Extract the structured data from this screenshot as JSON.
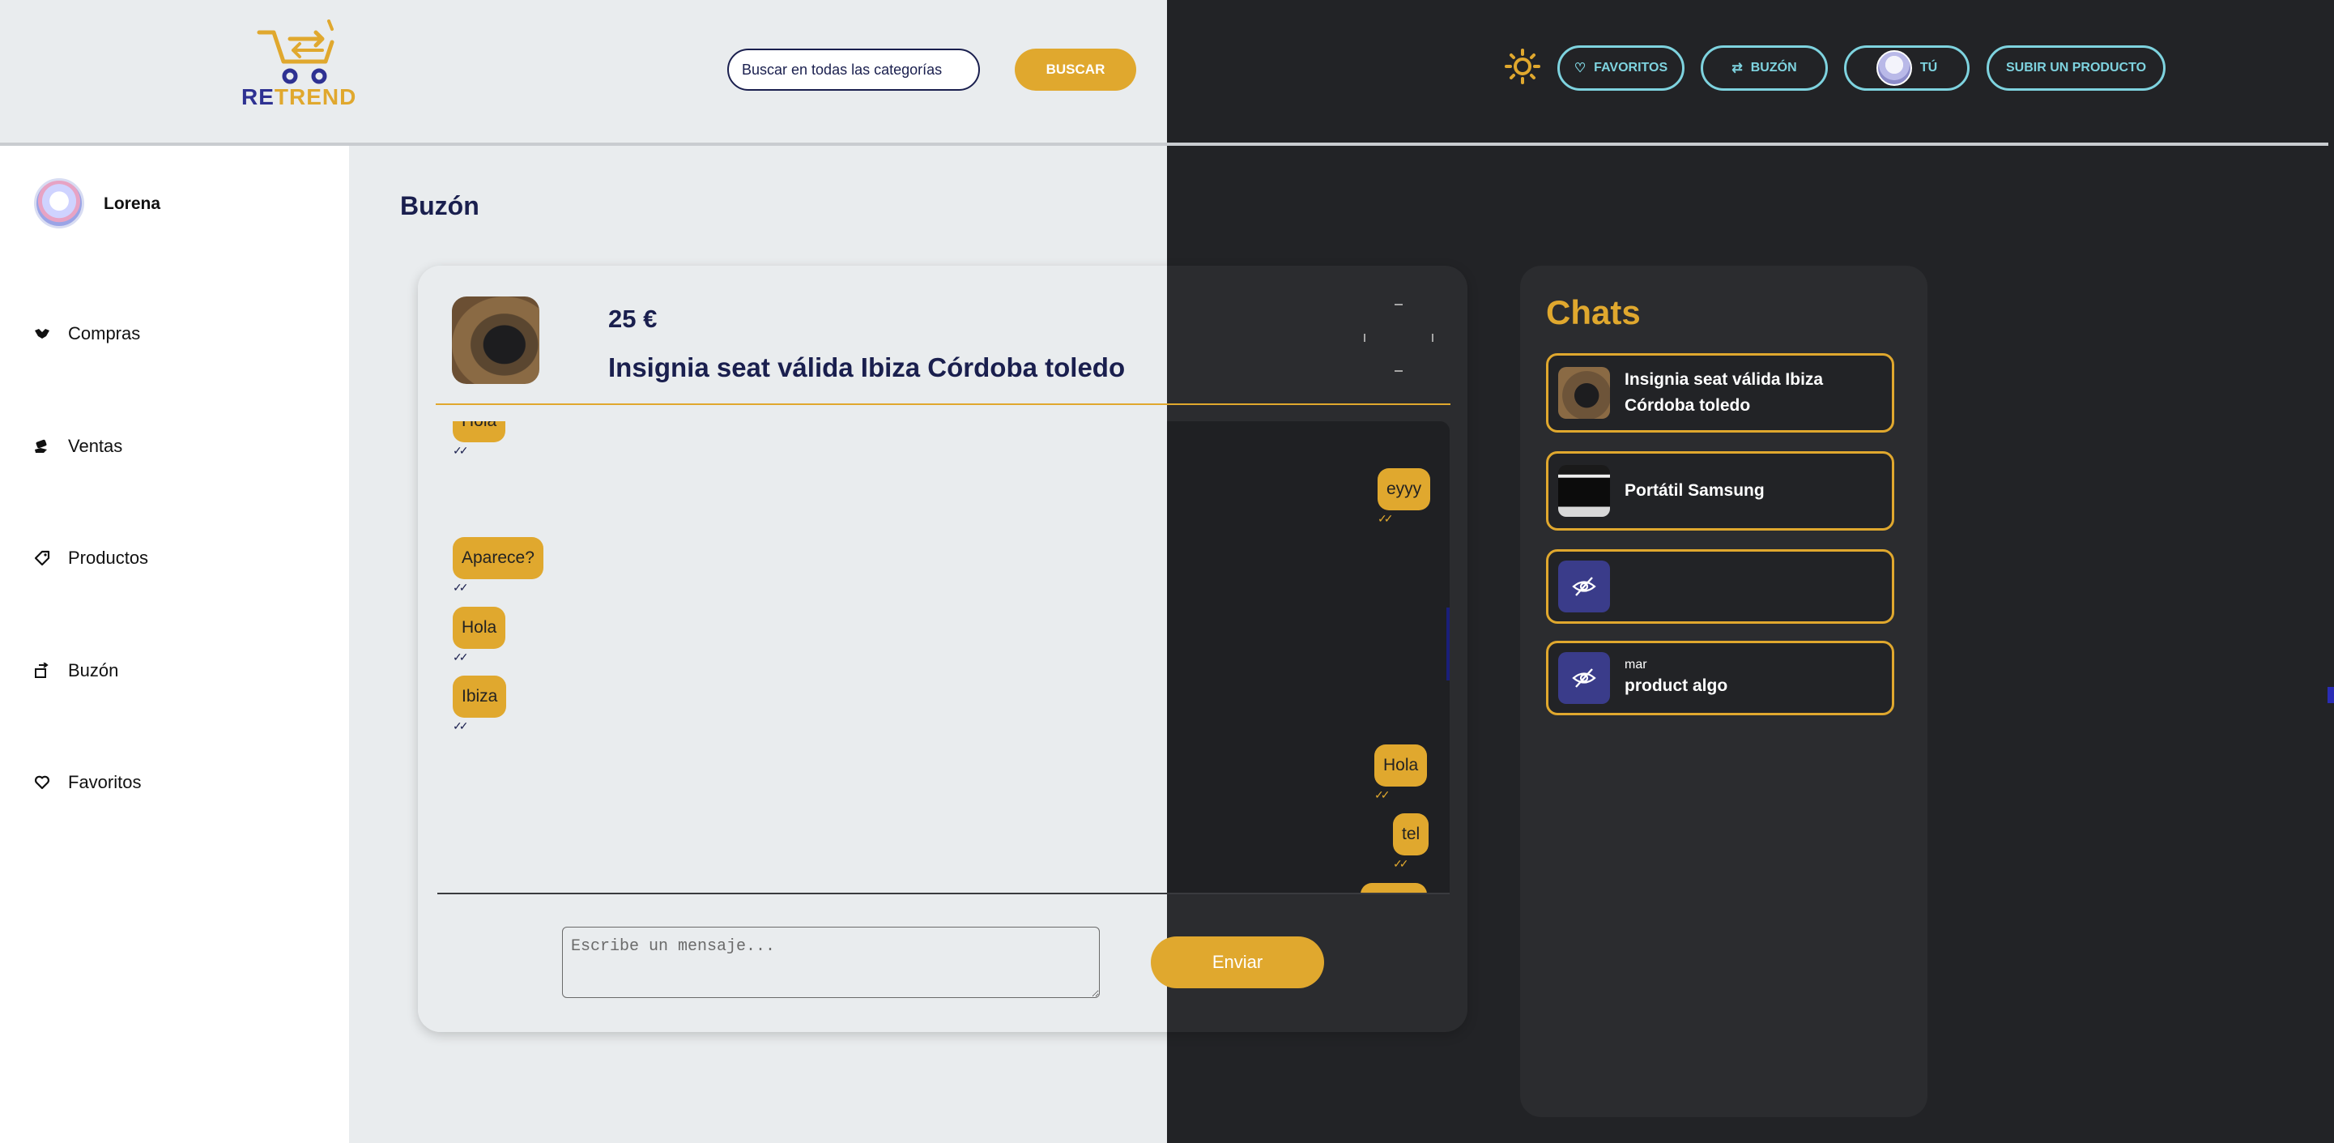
{
  "header": {
    "logo": {
      "re": "RE",
      "trend": "TREND"
    },
    "search": {
      "placeholder": "Buscar en todas las categorías",
      "button_label": "BUSCAR"
    },
    "nav": {
      "favoritos": "FAVORITOS",
      "buzon": "BUZÓN",
      "tu": "TÚ",
      "upload": "SUBIR UN PRODUCTO"
    }
  },
  "sidebar": {
    "user_name": "Lorena",
    "items": [
      {
        "label": "Compras",
        "icon": "handshake-icon"
      },
      {
        "label": "Ventas",
        "icon": "money-hand-icon"
      },
      {
        "label": "Productos",
        "icon": "tag-icon"
      },
      {
        "label": "Buzón",
        "icon": "transfer-icon"
      },
      {
        "label": "Favoritos",
        "icon": "heart-icon"
      }
    ]
  },
  "page": {
    "title": "Buzón"
  },
  "conversation": {
    "product_price": "25 €",
    "product_title": "Insignia seat válida Ibiza Córdoba toledo",
    "messages": [
      {
        "text": "Hola",
        "side": "left"
      },
      {
        "text": "eyyy",
        "side": "right"
      },
      {
        "text": "Aparece?",
        "side": "left"
      },
      {
        "text": "Hola",
        "side": "left"
      },
      {
        "text": "Ibiza",
        "side": "left"
      },
      {
        "text": "Hola",
        "side": "right"
      },
      {
        "text": "tel",
        "side": "right"
      }
    ],
    "tick": "✓✓",
    "composer": {
      "placeholder": "Escribe un mensaje...",
      "send_label": "Enviar"
    }
  },
  "chats": {
    "title": "Chats",
    "items": [
      {
        "title": "Insignia seat válida Ibiza Córdoba toledo",
        "subtitle": "",
        "thumb": "insignia"
      },
      {
        "title": "Portátil Samsung",
        "subtitle": "",
        "thumb": "laptop"
      },
      {
        "title": "",
        "subtitle": "",
        "thumb": "eye-off-icon"
      },
      {
        "title": "product algo",
        "subtitle": "mar",
        "thumb": "eye-off-icon"
      }
    ]
  },
  "colors": {
    "accent": "#e0a82e",
    "navy": "#1a1f4e",
    "cyan": "#7ed3df",
    "dark_panel": "#2b2c2f",
    "light_bg": "#e9ecee"
  }
}
